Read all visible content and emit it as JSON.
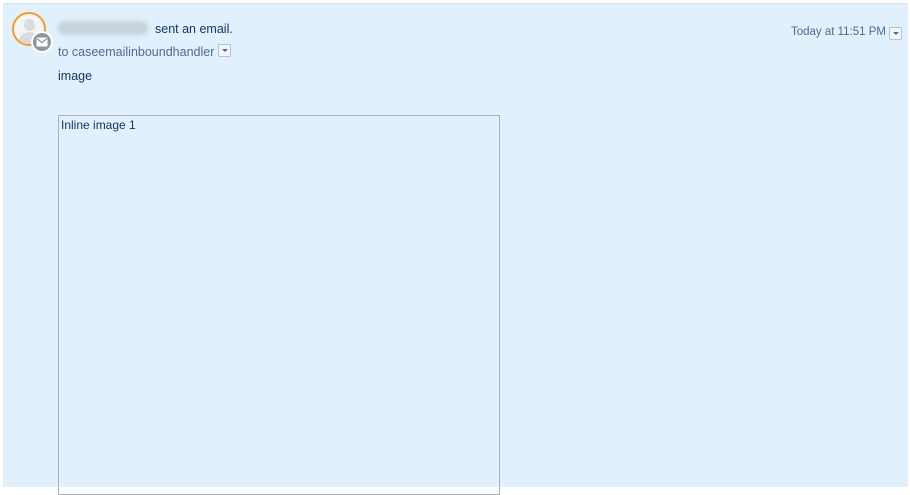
{
  "post": {
    "action_text": "sent an email.",
    "to_text": "to caseemailinboundhandler",
    "timestamp": "Today at 11:51 PM",
    "body_text": "image",
    "inline_image_alt": "Inline image 1"
  },
  "icons": {
    "avatar": "user-avatar-icon",
    "badge": "envelope-icon",
    "dropdown": "chevron-down-icon"
  },
  "colors": {
    "background": "#e0f0fc",
    "avatar_ring": "#f39c2e",
    "text": "#16325c",
    "muted_text": "#54698d"
  }
}
